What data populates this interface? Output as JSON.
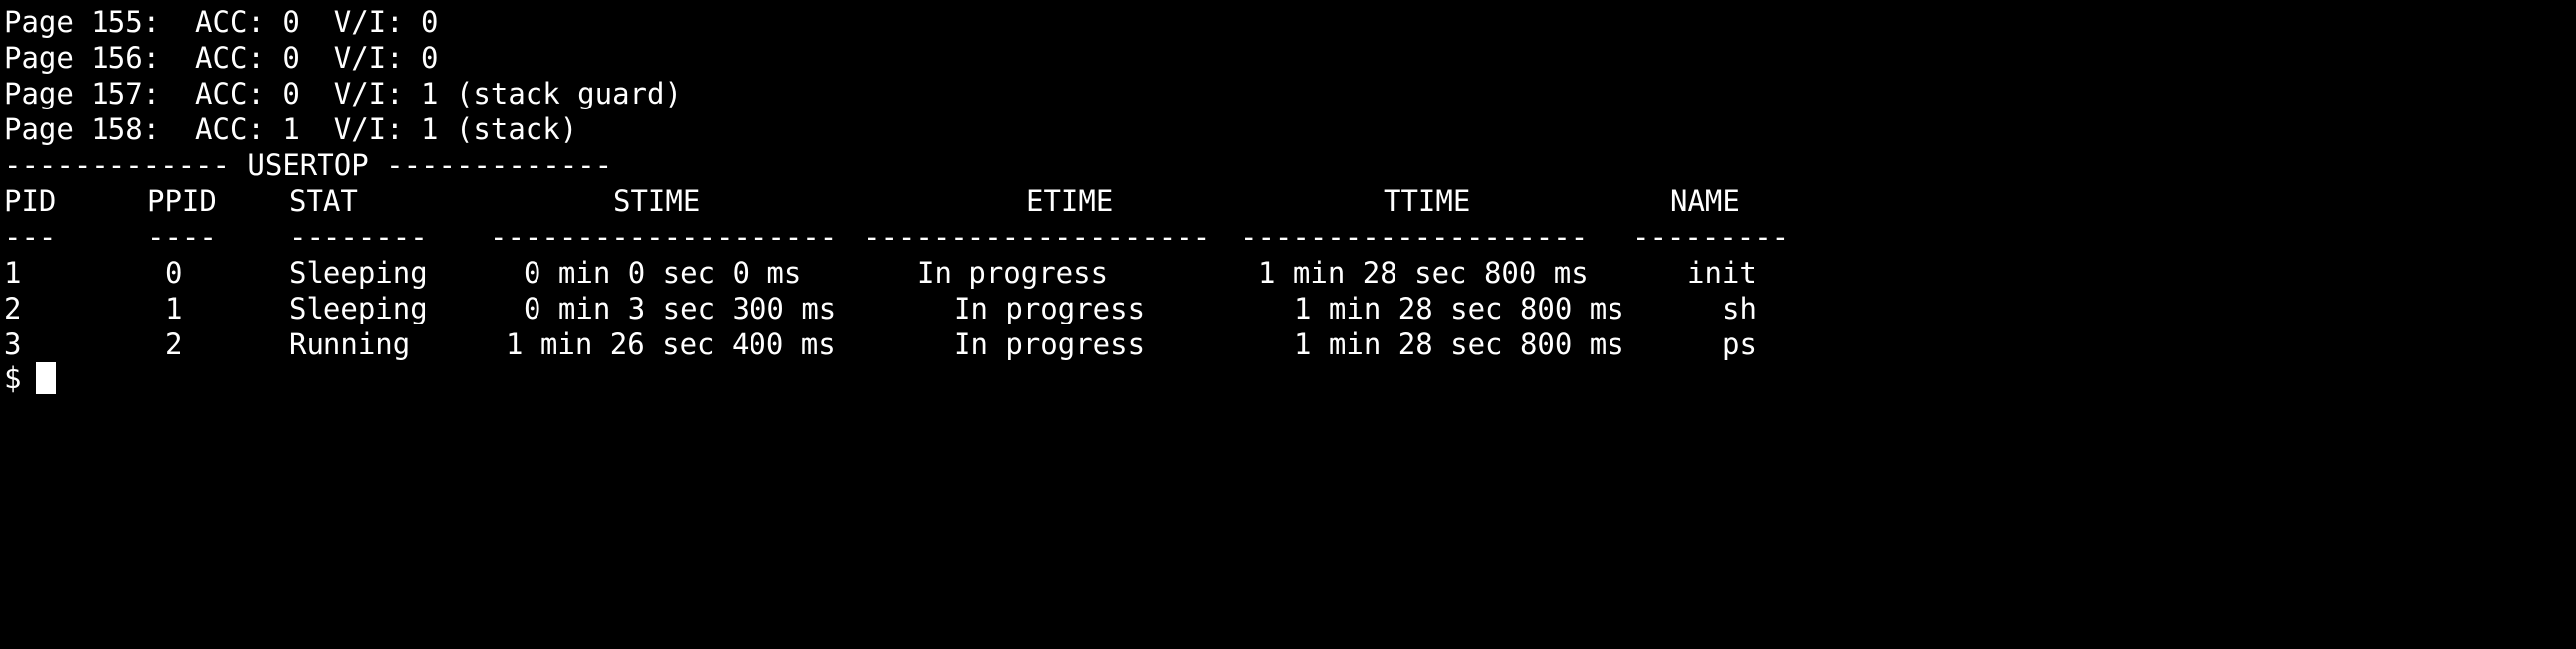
{
  "terminal": {
    "colors": {
      "background": "#000000",
      "foreground": "#ffffff"
    },
    "page_lines": [
      "Page 155:  ACC: 0  V/I: 0",
      "Page 156:  ACC: 0  V/I: 0",
      "Page 157:  ACC: 0  V/I: 1 (stack guard)",
      "Page 158:  ACC: 1  V/I: 1 (stack)"
    ],
    "usertop_banner": "------------- USERTOP -------------",
    "headers": {
      "pid": "PID",
      "ppid": "PPID",
      "stat": "STAT",
      "stime": "STIME",
      "etime": "ETIME",
      "ttime": "TTIME",
      "name": "NAME"
    },
    "separators": {
      "pid": "---",
      "ppid": "----",
      "stat": "--------",
      "stime": "--------------------",
      "etime": "--------------------",
      "ttime": "--------------------",
      "name": "---------"
    },
    "processes": [
      {
        "pid": "1",
        "ppid": "0",
        "stat": "Sleeping",
        "stime": "0 min 0 sec 0 ms",
        "etime": "In progress",
        "ttime": "1 min 28 sec 800 ms",
        "name": "init"
      },
      {
        "pid": "2",
        "ppid": "1",
        "stat": "Sleeping",
        "stime": "0 min 3 sec 300 ms",
        "etime": "In progress",
        "ttime": "1 min 28 sec 800 ms",
        "name": "sh"
      },
      {
        "pid": "3",
        "ppid": "2",
        "stat": "Running",
        "stime": "1 min 26 sec 400 ms",
        "etime": "In progress",
        "ttime": "1 min 28 sec 800 ms",
        "name": "ps"
      }
    ],
    "prompt": "$"
  }
}
